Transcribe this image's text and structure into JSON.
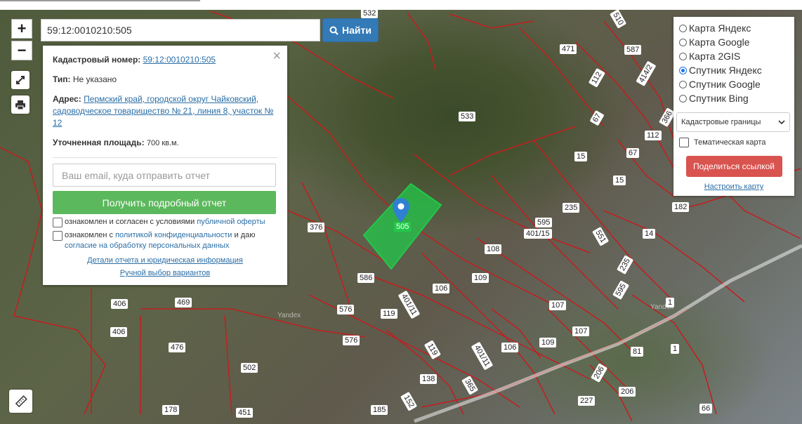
{
  "search": {
    "query": "59:12:0010210:505",
    "button_label": "Найти"
  },
  "zoom": {
    "in": "+",
    "out": "−"
  },
  "info": {
    "cadastral_label": "Кадастровый номер:",
    "cadastral_value": "59:12:0010210:505",
    "type_label": "Тип:",
    "type_value": "Не указано",
    "address_label": "Адрес:",
    "address_value": "Пермский край, городской округ Чайковский, садоводческое товарищество № 21, линия 8, участок № 12",
    "area_label": "Уточненная площадь:",
    "area_value": "700 кв.м.",
    "email_placeholder": "Ваш email, куда отправить отчет",
    "report_button": "Получить подробный отчет",
    "agree1_prefix": "ознакомлен и согласен с условиями",
    "agree1_link": "публичной оферты",
    "agree2_prefix": "ознакомлен с",
    "agree2_link1": "политикой конфиденциальности",
    "agree2_mid": "и даю",
    "agree2_link2": "согласие на обработку персональных данных",
    "details_link": "Детали отчета и юридическая информация",
    "manual_link": "Ручной выбор вариантов",
    "close": "×"
  },
  "layers": {
    "options": [
      {
        "label": "Карта Яндекс",
        "selected": false
      },
      {
        "label": "Карта Google",
        "selected": false
      },
      {
        "label": "Карта 2GIS",
        "selected": false
      },
      {
        "label": "Спутник Яндекс",
        "selected": true
      },
      {
        "label": "Спутник Google",
        "selected": false
      },
      {
        "label": "Спутник Bing",
        "selected": false
      }
    ],
    "select_value": "Кадастровые границы",
    "thematic_label": "Тематическая карта",
    "share_button": "Поделиться ссылкой",
    "adjust_link": "Настроить карту"
  },
  "map": {
    "selected_plot": "505",
    "plot_labels": [
      "532",
      "510",
      "471",
      "587",
      "414/2",
      "112",
      "533",
      "67",
      "366",
      "112",
      "15",
      "67",
      "15",
      "235",
      "182",
      "14",
      "595",
      "401/15",
      "551",
      "108",
      "376",
      "235",
      "595",
      "586",
      "109",
      "106",
      "401/11",
      "107",
      "1",
      "406",
      "469",
      "576",
      "119",
      "406",
      "476",
      "576",
      "119",
      "107",
      "109",
      "81",
      "1",
      "502",
      "106",
      "401/11",
      "138",
      "365",
      "206",
      "206",
      "178",
      "451",
      "185",
      "152",
      "227",
      "66"
    ],
    "watermarks": [
      "Yandex",
      "Yandex"
    ],
    "colors": {
      "boundary": "#c41e1e",
      "selected_fill": "#22c84a",
      "marker": "#2f80d1"
    }
  }
}
